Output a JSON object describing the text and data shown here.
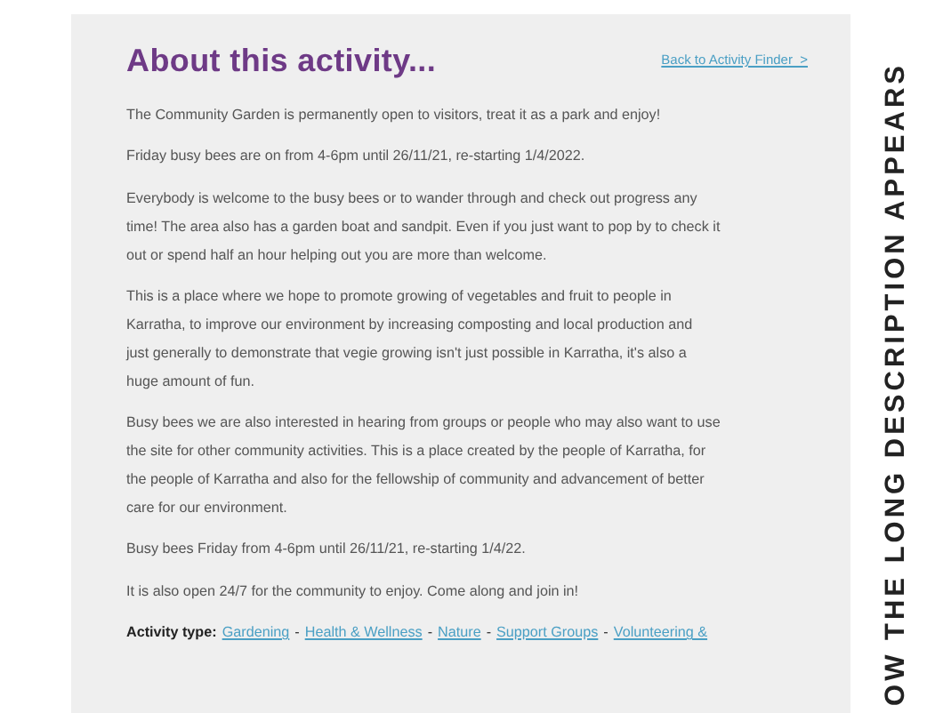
{
  "heading": "About this activity...",
  "back_link": "Back to Activity Finder  >",
  "paragraphs": [
    [
      "The Community Garden is permanently open to visitors, treat it as a park and enjoy!"
    ],
    [
      "Friday busy bees are on from 4-6pm until 26/11/21, re-starting 1/4/2022."
    ],
    [
      "Everybody is welcome to the busy bees or to wander through and check out progress any",
      "time! The area also has a garden boat and sandpit. Even if you just want to pop by to check it",
      "out or spend half an hour helping out you are more than welcome."
    ],
    [
      "This is a place where we hope to promote growing of vegetables and fruit to people in",
      "Karratha, to improve our environment by increasing composting and local production and",
      "just generally to demonstrate that vegie growing isn't just possible in Karratha, it's also a",
      "huge amount of fun."
    ],
    [
      "Busy bees we are also interested in hearing from groups or people who may also want to use",
      "the site for other community activities. This is a place created by the people of Karratha, for",
      "the people of Karratha and also for the fellowship of community and advancement of better",
      "care for our environment."
    ],
    [
      "Busy bees Friday from 4-6pm until 26/11/21, re-starting 1/4/22."
    ],
    [
      "It is also open 24/7 for the community to enjoy. Come along and join in!"
    ]
  ],
  "activity_type": {
    "label": "Activity type:",
    "separator": "-",
    "tags": [
      "Gardening",
      "Health & Wellness",
      "Nature",
      "Support Groups",
      "Volunteering &"
    ]
  },
  "side_caption": "OW THE LONG DESCRIPTION APPEARS"
}
